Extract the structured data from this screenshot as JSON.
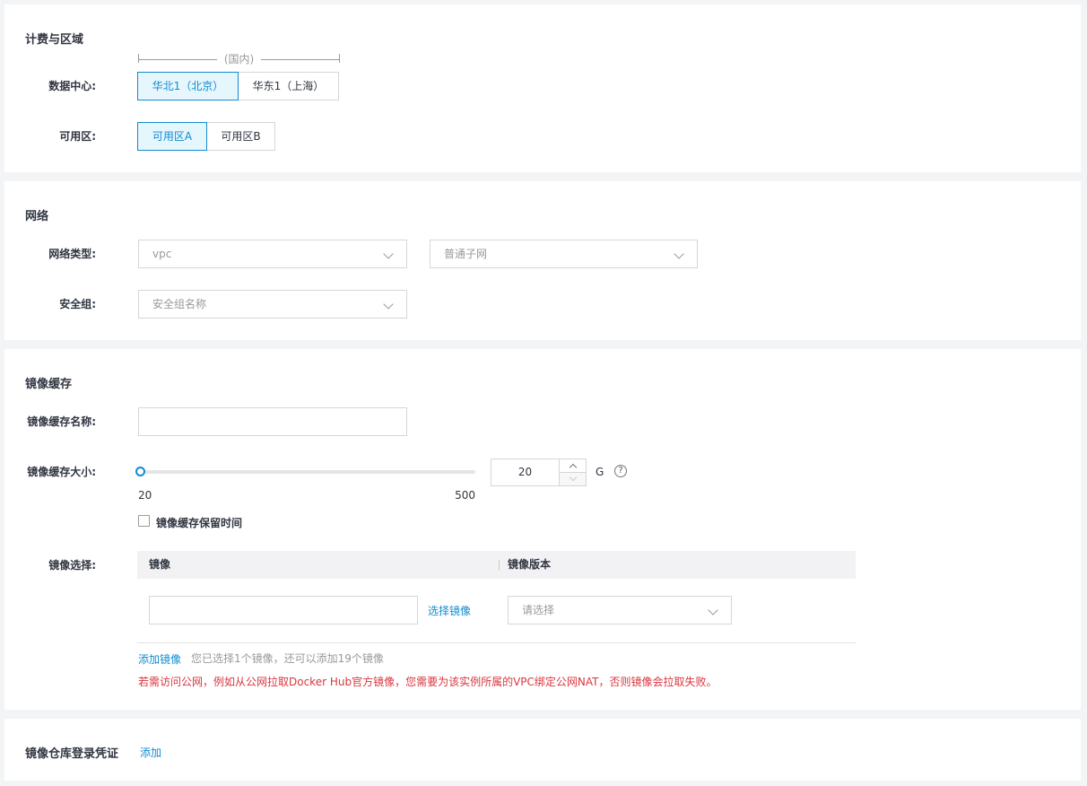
{
  "billing": {
    "title": "计费与区域",
    "region_group": "(国内)",
    "datacenter_label": "数据中心:",
    "datacenters": [
      "华北1（北京）",
      "华东1（上海）"
    ],
    "zone_label": "可用区:",
    "zones": [
      "可用区A",
      "可用区B"
    ]
  },
  "network": {
    "title": "网络",
    "type_label": "网络类型:",
    "vpc_value": "vpc",
    "subnet_placeholder": "普通子网",
    "sg_label": "安全组:",
    "sg_placeholder": "安全组名称"
  },
  "cache": {
    "title": "镜像缓存",
    "name_label": "镜像缓存名称:",
    "name_value": "",
    "size_label": "镜像缓存大小:",
    "size_min": "20",
    "size_max": "500",
    "size_value": "20",
    "size_unit": "G",
    "help_icon": "?",
    "retention_label": "镜像缓存保留时间",
    "image_select_label": "镜像选择:",
    "col_image": "镜像",
    "col_version": "镜像版本",
    "select_image_link": "选择镜像",
    "version_placeholder": "请选择",
    "add_image": "添加镜像",
    "add_hint": "您已选择1个镜像，还可以添加19个镜像",
    "warning": "若需访问公网，例如从公网拉取Docker Hub官方镜像，您需要为该实例所属的VPC绑定公网NAT，否则镜像会拉取失败。"
  },
  "registry": {
    "title": "镜像仓库登录凭证",
    "add_link": "添加"
  },
  "colors": {
    "accent": "#108cd1",
    "warning": "#d9363e"
  }
}
